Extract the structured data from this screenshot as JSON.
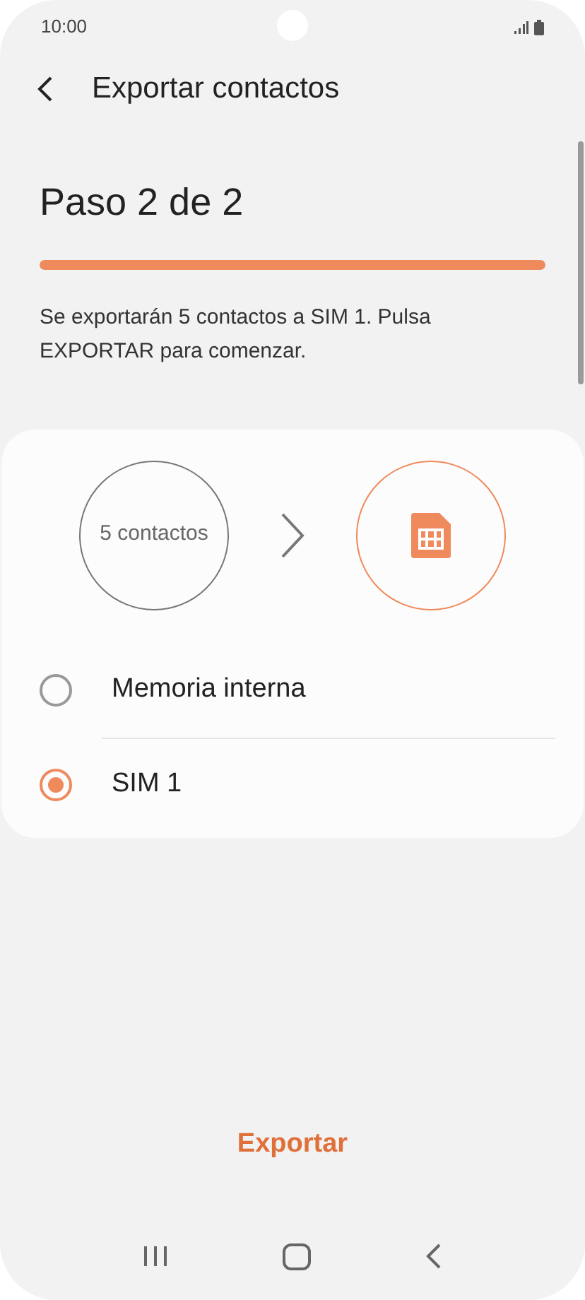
{
  "status_bar": {
    "time": "10:00"
  },
  "header": {
    "title": "Exportar contactos"
  },
  "step": {
    "title": "Paso 2 de 2",
    "level": 1
  },
  "description": "Se exportarán 5 contactos a SIM 1. Pulsa EXPORTAR para comenzar.",
  "transfer": {
    "source": "5 contactos"
  },
  "options": [
    {
      "label": "Memoria interna",
      "selected": false
    },
    {
      "label": "SIM 1",
      "selected": true
    }
  ],
  "action": "Exportar"
}
